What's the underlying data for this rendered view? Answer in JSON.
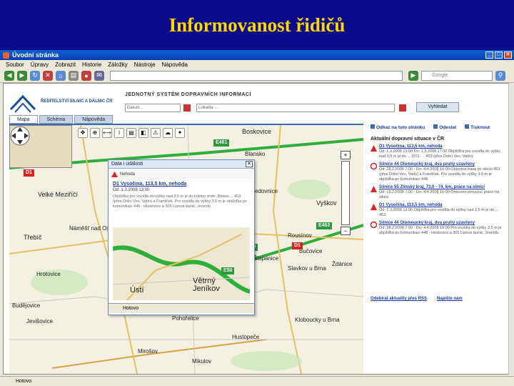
{
  "slide": {
    "title": "Informovanost řidičů"
  },
  "browser": {
    "window_title": "Úvodní stránka",
    "menu": [
      "Soubor",
      "Úpravy",
      "Zobrazit",
      "Historie",
      "Záložky",
      "Nástroje",
      "Nápověda"
    ],
    "search_placeholder": "Google",
    "status_text": "Hotovo"
  },
  "site": {
    "logo_text": "ŘEDITELSTVÍ SILNIC A DÁLNIC ČR",
    "system_title": "JEDNOTNÝ SYSTÉM DOPRAVNÍCH INFORMACÍ",
    "date_placeholder": "Datum...",
    "location_placeholder": "Lokalita ...",
    "search_button": "Vyhledat",
    "tabs": [
      "Mapa",
      "Schéma",
      "Nápověda"
    ]
  },
  "map": {
    "labels": [
      "Boskovice",
      "Velké Meziříčí",
      "Třebíč",
      "Náměšť nad Oslavou",
      "Hrotovice",
      "Budějovice",
      "Jevišovice",
      "Rousínov",
      "Bučovice",
      "Šlapanice",
      "Slavkov u Brna",
      "Ždánice",
      "Kloboucky u Brna",
      "Hustopeče",
      "Mikulov",
      "Pohořelice",
      "Mirošov",
      "Vyškov",
      "Jedovnice",
      "Blansko"
    ],
    "shields": [
      "D1",
      "E461",
      "E50",
      "E462",
      "E50"
    ]
  },
  "popup": {
    "header": "Data i události",
    "subheader": "Nehoda",
    "title": "D1 Vysočina, 113,5 km, nehoda",
    "from": "Od: 1.3.2008 13:00",
    "desc": "Objížďka pro vozidla do výšky nad 3,5 m je do kolony směr Jihlava ... 453 (přes Dolní Ves, Vatín) a Frantiček. Pro vozidla do výšky 3,5 m je objížďka po komunikaci 448 - Hustovice a 305 Lipová lázně, Jeseník.",
    "map_labels": [
      "Ústí",
      "Větrný Jeníkov"
    ],
    "map_shield": "E50",
    "status": "Hotovo"
  },
  "side": {
    "top_links": [
      "Odkaz na tuto stránku",
      "Odeslat",
      "Tisknout"
    ],
    "heading": "Aktuální dopravní situace v ČR",
    "events": [
      {
        "type": "warn",
        "title": "D1 Vysočina, 113,5 km, nehoda",
        "desc": "Od: 1.3.2008 13:00  Do: 1.3.2008 17:00  Objížďka pro vozidla do výšky nad 3,5 m je do ... (D1), ... 453 (přes Dolní Ves, Vatín)."
      },
      {
        "type": "stop",
        "title": "Silnice 44 Olomoucký kraj, dva pruhy uzavřeny",
        "desc": "Od: 28.2.2008 7:00 - Do: 4.4.2008 16:00  Objízdná trasa po silnici 453 (přes Dolní Ves, Vatín) a Frantiček. Pro vozidla do výšky 3,5 m je objížďka po komunikaci 448."
      },
      {
        "type": "warn",
        "title": "Silnice 55 Zlínský kraj, 73,0 - 74, km, práce na silnici",
        "desc": "Od: 15.2.2008 7:00 - Do: 4.4.2008 16:00  Omezení provozu, práce na silnici."
      },
      {
        "type": "warn",
        "title": "D1 Vysočina, 113,5 km, nehoda",
        "desc": "Od: 1.3.2008 13:00  Objížďka pro vozidla do výšky nad 3,5 m je do ... 453."
      },
      {
        "type": "stop",
        "title": "Silnice 44 Olomoucký kraj, dva pruhy uzavřeny",
        "desc": "Od: 28.2.2008 7:00 - Do: 4.4.2008 16:00  Pro vozidla do výšky 3,5 m je objížďka po komunikaci 448 - Hustovice a 305 Lipová lázně, Jeseník."
      }
    ],
    "footer": [
      "Odebírat aktuality přes RSS",
      "Napište nám"
    ]
  },
  "colors": {
    "slide_bg": "#0a0a8a",
    "title": "#ffd700",
    "link": "#1a3aa8",
    "highway": "#2eae3a",
    "alert": "#d22222"
  }
}
